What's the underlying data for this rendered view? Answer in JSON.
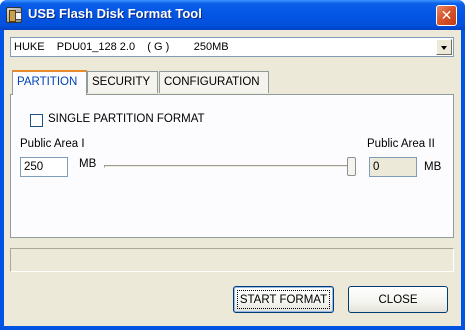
{
  "window": {
    "title": "USB Flash Disk Format Tool",
    "close_glyph": "✕"
  },
  "device_select": {
    "value": "HUKE    PDU01_128 2.0    ( G )        250MB"
  },
  "tabs": [
    {
      "label": "PARTITION",
      "active": true
    },
    {
      "label": "SECURITY",
      "active": false
    },
    {
      "label": "CONFIGURATION",
      "active": false
    }
  ],
  "partition": {
    "single_partition_label": "SINGLE PARTITION FORMAT",
    "single_partition_checked": false,
    "public_area_1_label": "Public Area I",
    "public_area_1_value": "250",
    "public_area_1_unit": "MB",
    "public_area_2_label": "Public Area II",
    "public_area_2_value": "0",
    "public_area_2_unit": "MB",
    "slider_fraction": 1.0
  },
  "status": {
    "text": ""
  },
  "buttons": {
    "start_format": "START FORMAT",
    "close": "CLOSE"
  },
  "colors": {
    "titlebar": "#0355e4",
    "dialog_bg": "#ece9d8",
    "active_tab_text": "#0043b8",
    "active_tab_accent": "#e68b2c",
    "close_button": "#d9552c"
  }
}
